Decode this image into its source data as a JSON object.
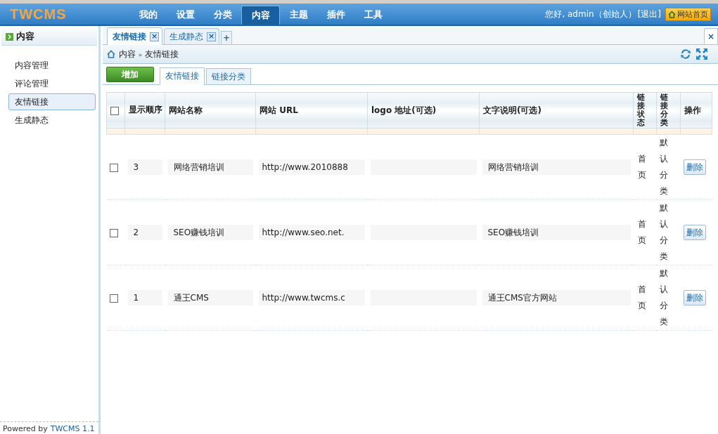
{
  "header": {
    "logo": "TWCMS",
    "nav": [
      {
        "label": "我的",
        "selected": false
      },
      {
        "label": "设置",
        "selected": false
      },
      {
        "label": "分类",
        "selected": false
      },
      {
        "label": "内容",
        "selected": true
      },
      {
        "label": "主题",
        "selected": false
      },
      {
        "label": "插件",
        "selected": false
      },
      {
        "label": "工具",
        "selected": false
      }
    ],
    "greeting": "您好, admin（创始人）",
    "logout": "[退出]",
    "home_button": "网站首页"
  },
  "sidebar": {
    "title": "内容",
    "items": [
      {
        "label": "内容管理",
        "selected": false
      },
      {
        "label": "评论管理",
        "selected": false
      },
      {
        "label": "友情链接",
        "selected": true
      },
      {
        "label": "生成静态",
        "selected": false
      }
    ],
    "footer_text": "Powered by",
    "footer_link": "TWCMS 1.1"
  },
  "tabs": [
    {
      "label": "友情链接",
      "selected": true,
      "close": "×"
    },
    {
      "label": "生成静态",
      "selected": false,
      "close": "×"
    }
  ],
  "tab_add": "+",
  "close_all": "×",
  "breadcrumb": {
    "items": [
      "内容",
      "友情链接"
    ],
    "separator": "»"
  },
  "toolbar": {
    "add_button": "增加",
    "subtabs": [
      {
        "label": "友情链接",
        "selected": true
      },
      {
        "label": "链接分类",
        "selected": false
      }
    ]
  },
  "table": {
    "header_checked": false,
    "columns": [
      {
        "label": "显示顺序",
        "kind": "wrap"
      },
      {
        "label": "网站名称",
        "kind": "plain"
      },
      {
        "label": "网站 URL",
        "kind": "plain"
      },
      {
        "label": "logo 地址(可选)",
        "kind": "plain"
      },
      {
        "label": "文字说明(可选)",
        "kind": "plain"
      },
      {
        "label": "链接状态",
        "kind": "stack"
      },
      {
        "label": "链接分类",
        "kind": "stack"
      },
      {
        "label": "操作",
        "kind": "plain"
      }
    ],
    "rows": [
      {
        "checked": false,
        "order": "3",
        "name": "网络营销培训",
        "url": "http://www.2010888",
        "description": "网络营销培训",
        "status": "首页",
        "category": "默认分类",
        "action": "删除"
      },
      {
        "checked": false,
        "order": "2",
        "name": "SEO赚钱培训",
        "url": "http://www.seo.net.",
        "description": "SEO赚钱培训",
        "status": "首页",
        "category": "默认分类",
        "action": "删除"
      },
      {
        "checked": false,
        "order": "1",
        "name": "通王CMS",
        "url": "http://www.twcms.c",
        "description": "通王CMS官方网站",
        "status": "首页",
        "category": "默认分类",
        "action": "删除"
      }
    ]
  }
}
